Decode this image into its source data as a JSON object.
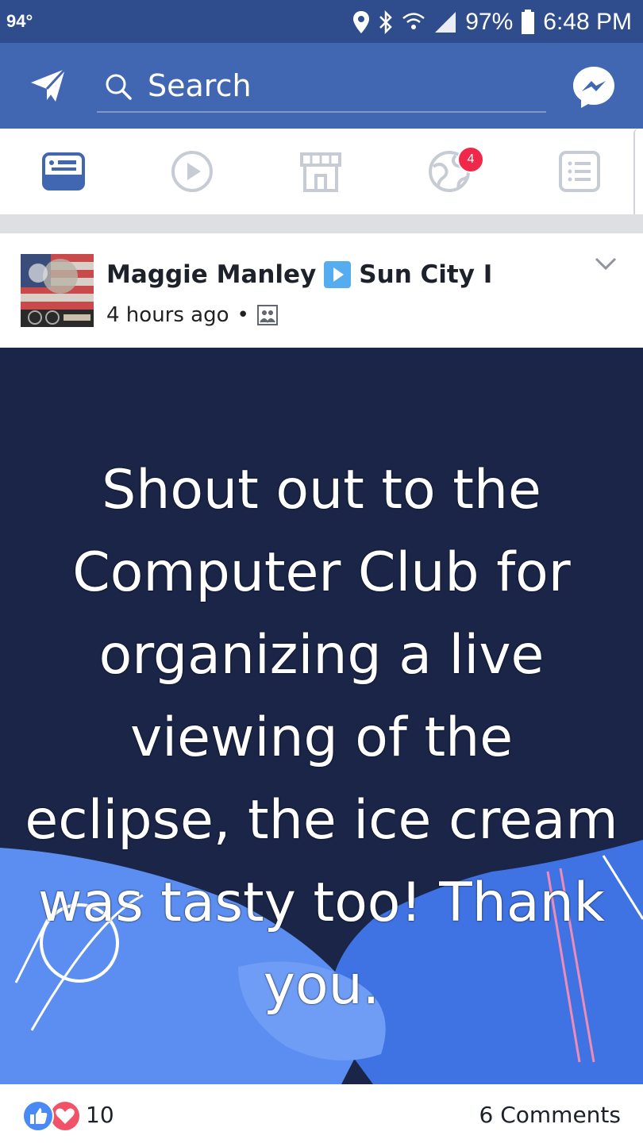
{
  "status_bar": {
    "temperature": "94°",
    "battery": "97%",
    "time": "6:48 PM",
    "icons": [
      "location-icon",
      "bluetooth-icon",
      "wifi-icon",
      "signal-icon",
      "battery-icon"
    ]
  },
  "top_bar": {
    "search_placeholder": "Search",
    "icons": [
      "send-icon",
      "search-icon",
      "messenger-icon"
    ],
    "color": "#4267b2"
  },
  "nav": {
    "items": [
      {
        "name": "news-feed",
        "icon": "news-feed-icon",
        "active": true
      },
      {
        "name": "watch",
        "icon": "video-icon",
        "active": false
      },
      {
        "name": "marketplace",
        "icon": "marketplace-icon",
        "active": false
      },
      {
        "name": "notifications",
        "icon": "globe-icon",
        "active": false,
        "badge": "4"
      },
      {
        "name": "menu",
        "icon": "menu-icon",
        "active": false
      }
    ]
  },
  "post": {
    "author": "Maggie Manley",
    "group": "Sun City I",
    "time": "4 hours ago",
    "privacy_icon": "group-icon",
    "text": "Shout out to the Computer Club for organizing a live viewing of the eclipse, the ice cream was tasty too!  Thank you.",
    "background_color": "#1b2548"
  },
  "footer": {
    "reaction_count": "10",
    "comments": "6 Comments",
    "reaction_icons": [
      "like-icon",
      "love-icon"
    ]
  }
}
